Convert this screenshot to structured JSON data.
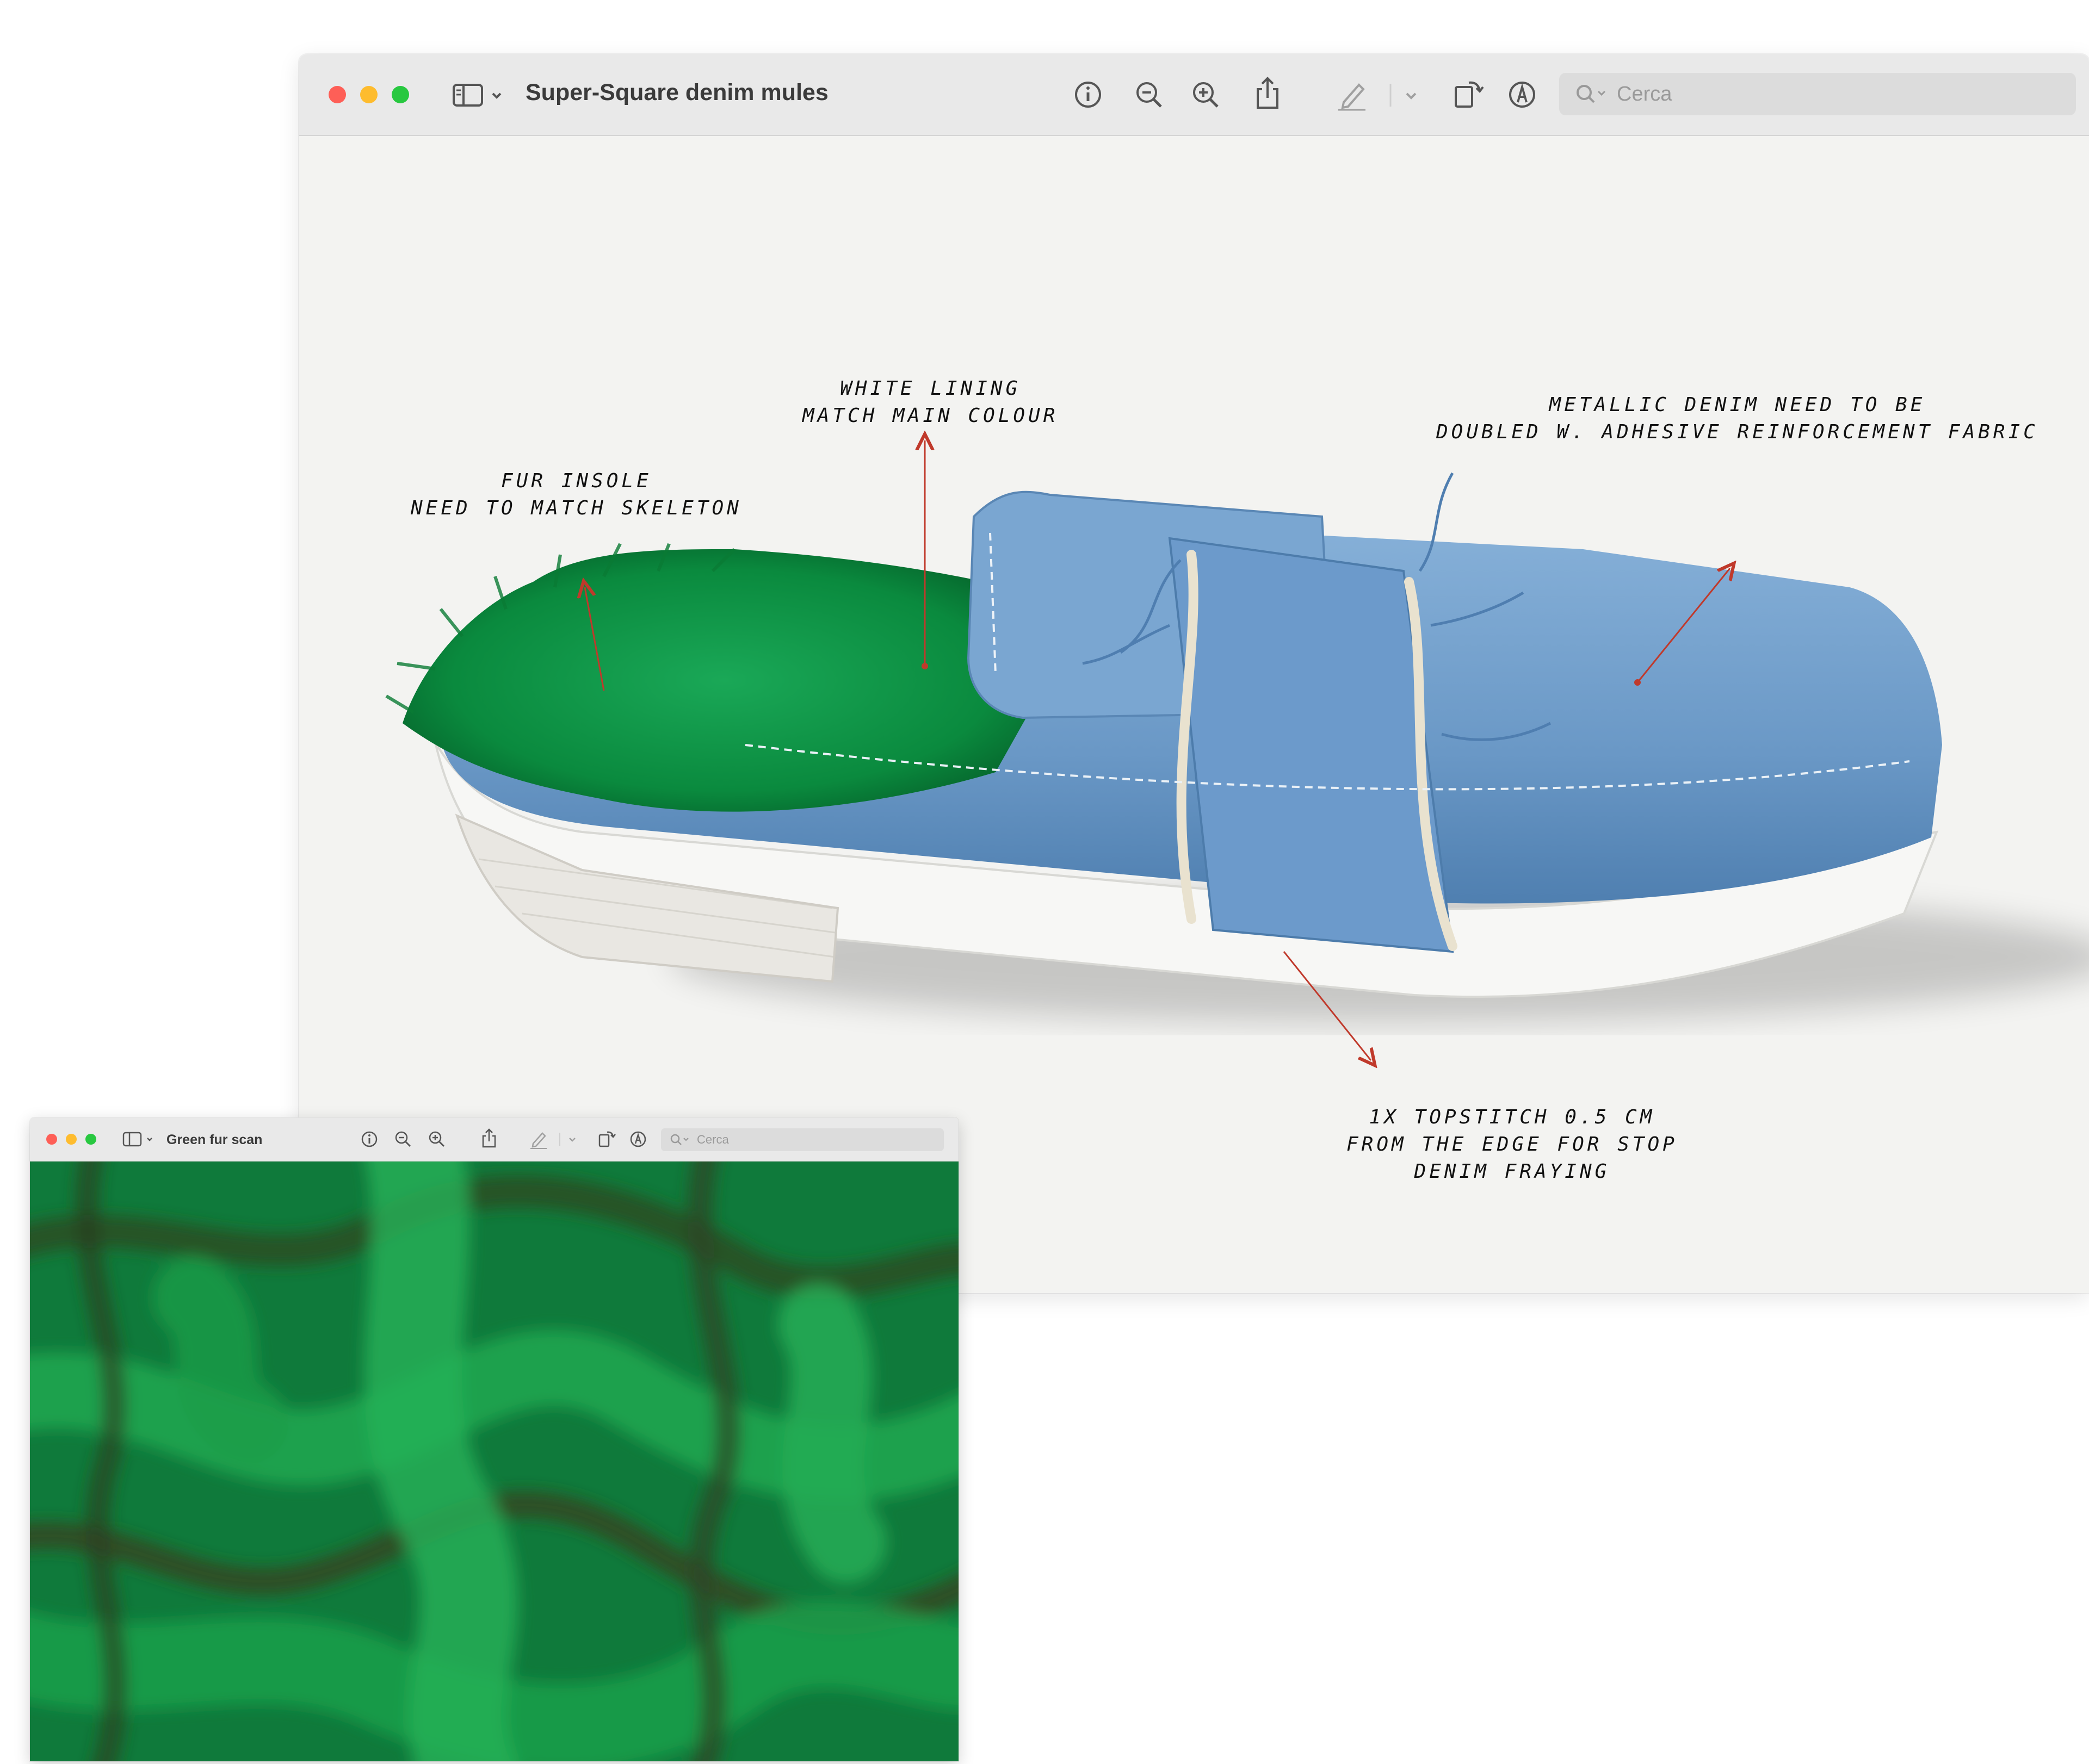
{
  "main_window": {
    "title": "Super-Square denim mules",
    "search_placeholder": "Cerca",
    "toolbar": {
      "sidebar_icon": "sidebar-icon",
      "info_icon": "info-icon",
      "zoom_out_icon": "zoom-out-icon",
      "zoom_in_icon": "zoom-in-icon",
      "share_icon": "share-icon",
      "markup_icon": "pencil-icon",
      "rotate_icon": "rotate-icon",
      "annotate_icon": "annotate-icon"
    },
    "annotations": {
      "lining": [
        "WHITE LINING",
        "MATCH MAIN COLOUR"
      ],
      "metallic": [
        "METALLIC DENIM NEED TO BE",
        "DOUBLED W. ADHESIVE REINFORCEMENT FABRIC"
      ],
      "insole": [
        "FUR INSOLE",
        "NEED TO MATCH SKELETON"
      ],
      "topstitch": [
        "1X TOPSTITCH 0.5 CM",
        "FROM THE EDGE FOR STOP",
        "DENIM FRAYING"
      ]
    }
  },
  "small_window": {
    "title": "Green fur scan",
    "search_placeholder": "Cerca"
  },
  "colors": {
    "traffic_red": "#fe5f57",
    "traffic_yellow": "#febc2e",
    "traffic_green": "#28c840",
    "denim": "#6e9bc9",
    "fur_green": "#0b8a3e",
    "annotation_arrow": "#c0392b"
  }
}
